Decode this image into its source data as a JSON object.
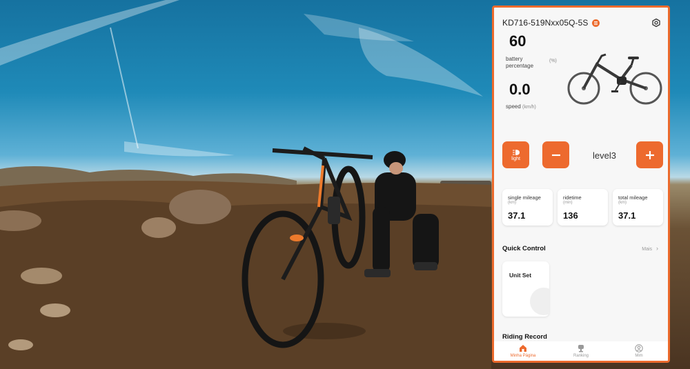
{
  "device": {
    "name": "KD716-519Nxx05Q-5S"
  },
  "stats": {
    "battery_value": "60",
    "battery_label_1": "battery",
    "battery_label_2": "percentage",
    "battery_unit": "(%)",
    "speed_value": "0.0",
    "speed_label": "speed",
    "speed_unit": "(km/h)"
  },
  "controls": {
    "light_label": "light",
    "level": "level3"
  },
  "cards": [
    {
      "label": "single mileage",
      "unit": "(km)",
      "value": "37.1"
    },
    {
      "label": "ridetime",
      "unit": "(min)",
      "value": "136"
    },
    {
      "label": "total mileage",
      "unit": "(km)",
      "value": "37.1"
    }
  ],
  "quick_control": {
    "title": "Quick Control",
    "more": "Mais",
    "card_title": "Unit Set"
  },
  "riding_record": {
    "title": "Riding Record"
  },
  "tabs": [
    {
      "label": "Minha Página"
    },
    {
      "label": "Ranking"
    },
    {
      "label": "Mim"
    }
  ],
  "colors": {
    "accent": "#ed6a2e",
    "frame": "#ec6a2c"
  }
}
